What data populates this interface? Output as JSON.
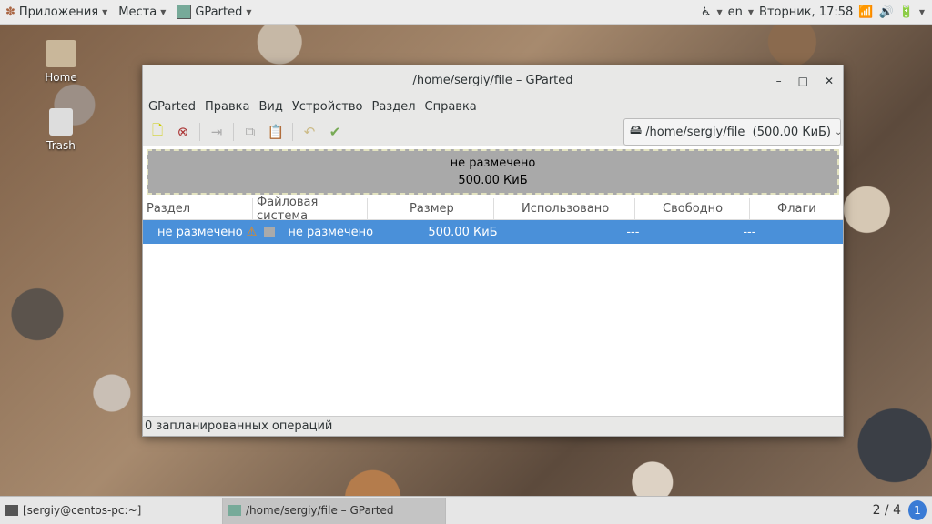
{
  "topbar": {
    "apps": "Приложения",
    "places": "Места",
    "active_app": "GParted",
    "lang": "en",
    "datetime": "Вторник, 17:58"
  },
  "desktop": {
    "icons": [
      {
        "label": "Home"
      },
      {
        "label": "Trash"
      }
    ]
  },
  "window": {
    "title": "/home/sergiy/file – GParted",
    "menu": [
      "GParted",
      "Правка",
      "Вид",
      "Устройство",
      "Раздел",
      "Справка"
    ],
    "device": "/home/sergiy/file  (500.00 КиБ)",
    "visual": {
      "label": "не размечено",
      "size": "500.00 КиБ"
    },
    "columns": [
      "Раздел",
      "Файловая система",
      "Размер",
      "Использовано",
      "Свободно",
      "Флаги"
    ],
    "rows": [
      {
        "partition": "не размечено",
        "fs": "не размечено",
        "size": "500.00 КиБ",
        "used": "---",
        "free": "---",
        "flags": ""
      }
    ],
    "status": "0 запланированных операций"
  },
  "taskbar": {
    "tasks": [
      "[sergiy@centos-pc:~]",
      "/home/sergiy/file – GParted"
    ],
    "workspace": "2 / 4",
    "notifications": "1"
  },
  "colors": {
    "selection": "#4a90d9",
    "unallocated": "#a9a9a9"
  }
}
